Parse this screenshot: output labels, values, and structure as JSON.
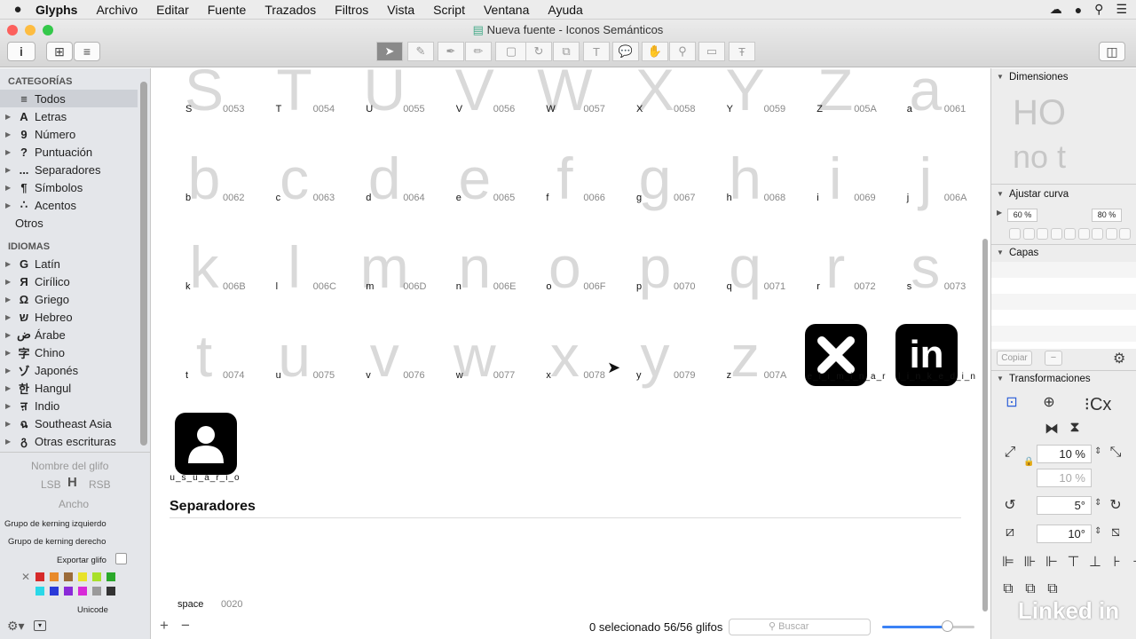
{
  "menubar": {
    "apple": "",
    "app": "Glyphs",
    "items": [
      "Archivo",
      "Editar",
      "Fuente",
      "Trazados",
      "Filtros",
      "Vista",
      "Script",
      "Ventana",
      "Ayuda"
    ]
  },
  "window": {
    "title": "Nueva fuente - Iconos Semánticos"
  },
  "sidebar": {
    "categories_header": "CATEGORÍAS",
    "categories": [
      {
        "label": "Todos",
        "icon": "≡"
      },
      {
        "label": "Letras",
        "icon": "A"
      },
      {
        "label": "Número",
        "icon": "9"
      },
      {
        "label": "Puntuación",
        "icon": "?"
      },
      {
        "label": "Separadores",
        "icon": "..."
      },
      {
        "label": "Símbolos",
        "icon": "¶"
      },
      {
        "label": "Acentos",
        "icon": "∴"
      },
      {
        "label": "Otros",
        "icon": ""
      }
    ],
    "languages_header": "IDIOMAS",
    "languages": [
      {
        "label": "Latín",
        "icon": "G"
      },
      {
        "label": "Cirílico",
        "icon": "Я"
      },
      {
        "label": "Griego",
        "icon": "Ω"
      },
      {
        "label": "Hebreo",
        "icon": "ש"
      },
      {
        "label": "Árabe",
        "icon": "ض"
      },
      {
        "label": "Chino",
        "icon": "字"
      },
      {
        "label": "Japonés",
        "icon": "ゾ"
      },
      {
        "label": "Hangul",
        "icon": "한"
      },
      {
        "label": "Indio",
        "icon": "ऩ"
      },
      {
        "label": "Southeast Asia",
        "icon": "ฉ"
      },
      {
        "label": "Otras escrituras",
        "icon": "გ"
      }
    ],
    "glyph_name_label": "Nombre del glifo",
    "lsb": "LSB",
    "rsb": "RSB",
    "width": "Ancho",
    "kern_left": "Grupo de kerning izquierdo",
    "kern_right": "Grupo de kerning derecho",
    "export_glyph": "Exportar glifo",
    "unicode": "Unicode",
    "swatches": [
      "#d62a2a",
      "#e88a2a",
      "#9b6b3a",
      "#e8e22a",
      "#a8e02a",
      "#2aa82a",
      "#2ad8e8",
      "#2a3ad8",
      "#8a2ad8",
      "#d82ad8",
      "#9a9a9a",
      "#333333"
    ]
  },
  "grid": {
    "rows": [
      [
        {
          "g": "S",
          "n": "S",
          "c": "0053"
        },
        {
          "g": "T",
          "n": "T",
          "c": "0054"
        },
        {
          "g": "U",
          "n": "U",
          "c": "0055"
        },
        {
          "g": "V",
          "n": "V",
          "c": "0056"
        },
        {
          "g": "W",
          "n": "W",
          "c": "0057"
        },
        {
          "g": "X",
          "n": "X",
          "c": "0058"
        },
        {
          "g": "Y",
          "n": "Y",
          "c": "0059"
        },
        {
          "g": "Z",
          "n": "Z",
          "c": "005A"
        },
        {
          "g": "a",
          "n": "a",
          "c": "0061"
        }
      ],
      [
        {
          "g": "b",
          "n": "b",
          "c": "0062"
        },
        {
          "g": "c",
          "n": "c",
          "c": "0063"
        },
        {
          "g": "d",
          "n": "d",
          "c": "0064"
        },
        {
          "g": "e",
          "n": "e",
          "c": "0065"
        },
        {
          "g": "f",
          "n": "f",
          "c": "0066"
        },
        {
          "g": "g",
          "n": "g",
          "c": "0067"
        },
        {
          "g": "h",
          "n": "h",
          "c": "0068"
        },
        {
          "g": "i",
          "n": "i",
          "c": "0069"
        },
        {
          "g": "j",
          "n": "j",
          "c": "006A"
        }
      ],
      [
        {
          "g": "k",
          "n": "k",
          "c": "006B"
        },
        {
          "g": "l",
          "n": "l",
          "c": "006C"
        },
        {
          "g": "m",
          "n": "m",
          "c": "006D"
        },
        {
          "g": "n",
          "n": "n",
          "c": "006E"
        },
        {
          "g": "o",
          "n": "o",
          "c": "006F"
        },
        {
          "g": "p",
          "n": "p",
          "c": "0070"
        },
        {
          "g": "q",
          "n": "q",
          "c": "0071"
        },
        {
          "g": "r",
          "n": "r",
          "c": "0072"
        },
        {
          "g": "s",
          "n": "s",
          "c": "0073"
        }
      ],
      [
        {
          "g": "t",
          "n": "t",
          "c": "0074"
        },
        {
          "g": "u",
          "n": "u",
          "c": "0075"
        },
        {
          "g": "v",
          "n": "v",
          "c": "0076"
        },
        {
          "g": "w",
          "n": "w",
          "c": "0077"
        },
        {
          "g": "x",
          "n": "x",
          "c": "0078"
        },
        {
          "g": "y",
          "n": "y",
          "c": "0079"
        },
        {
          "g": "z",
          "n": "z",
          "c": "007A"
        }
      ]
    ],
    "icons": [
      {
        "name": "e_l_i_m_i_n_a_r",
        "icon": "close-icon"
      },
      {
        "name": "l_i_n_k_e_d_i_n",
        "icon": "linkedin-icon",
        "text": "in"
      },
      {
        "name": "u_s_u_a_r_i_o",
        "icon": "user-icon"
      }
    ],
    "separators_title": "Separadores",
    "space": {
      "n": "space",
      "c": "0020"
    }
  },
  "status": {
    "selection": "0 selecionado 56/56 glifos",
    "search_placeholder": "Buscar",
    "zoom": 0.7
  },
  "right_panel": {
    "dimensions": "Dimensiones",
    "preview_upper": "HO",
    "preview_lower": "no t",
    "curve": "Ajustar curva",
    "curve_left": "60 %",
    "curve_right": "80 %",
    "layers": "Capas",
    "copy": "Copiar",
    "transforms": "Transformaciones",
    "scale1": "10 %",
    "scale2": "10 %",
    "rotate": "5°",
    "slant": "10°"
  },
  "watermark": "Linked in"
}
